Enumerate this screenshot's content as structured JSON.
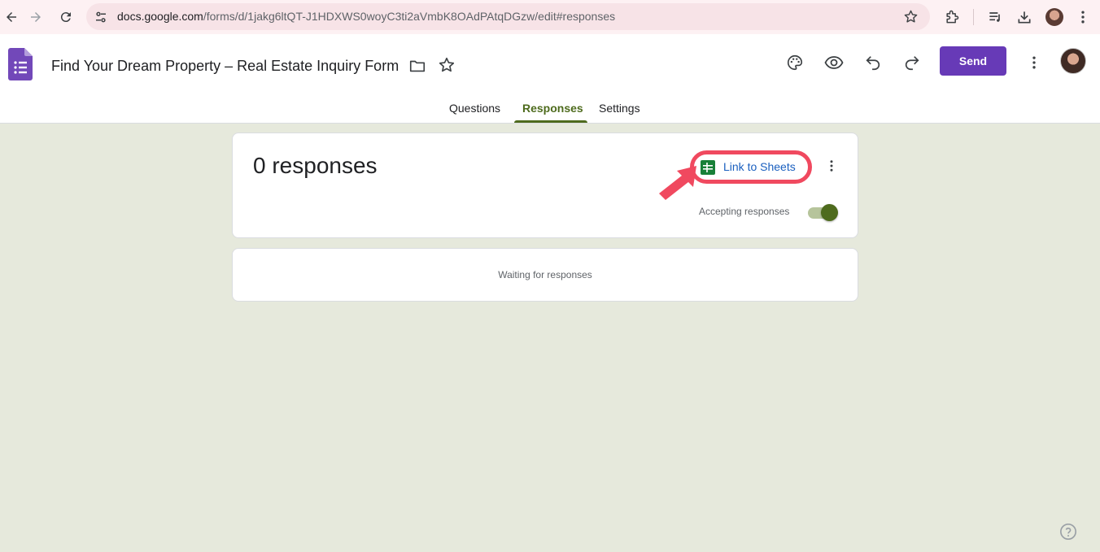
{
  "browser": {
    "url_host": "docs.google.com",
    "url_path": "/forms/d/1jakg6ltQT-J1HDXWS0woyC3ti2aVmbK8OAdPAtqDGzw/edit#responses",
    "icons": [
      "back-icon",
      "forward-icon",
      "reload-icon",
      "site-settings-icon",
      "bookmark-star-icon",
      "extensions-icon",
      "media-icon",
      "downloads-icon",
      "profile-icon",
      "menu-icon"
    ]
  },
  "header": {
    "title": "Find Your Dream Property – Real Estate Inquiry Form",
    "send_label": "Send",
    "icons": [
      "forms-logo",
      "folder-icon",
      "star-icon",
      "palette-icon",
      "preview-eye-icon",
      "undo-icon",
      "redo-icon",
      "more-vert-icon",
      "avatar"
    ]
  },
  "tabs": [
    {
      "label": "Questions",
      "active": false
    },
    {
      "label": "Responses",
      "active": true
    },
    {
      "label": "Settings",
      "active": false
    }
  ],
  "summary": {
    "count_label": "0 responses",
    "link_sheets_label": "Link to Sheets",
    "accepting_label": "Accepting responses",
    "accepting_on": true
  },
  "waiting": {
    "text": "Waiting for responses"
  },
  "colors": {
    "accent_purple": "#673ab7",
    "tab_active": "#4e6b1d",
    "page_bg": "#e6e9dc",
    "annotation_red": "#f0495f",
    "link_blue": "#1a5fbf"
  }
}
